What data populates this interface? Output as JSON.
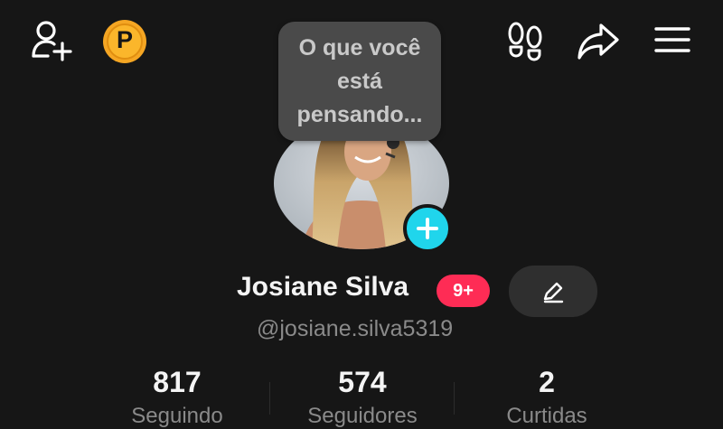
{
  "header": {
    "icons": [
      "add-friend-icon",
      "points-coin-icon",
      "footprints-icon",
      "share-icon",
      "menu-icon"
    ],
    "coin_letter": "P"
  },
  "profile": {
    "note_bubble": "O que você está pensando...",
    "name": "Josiane Silva",
    "notification_badge": "9+",
    "handle": "@josiane.silva5319"
  },
  "stats": [
    {
      "value": "817",
      "label": "Seguindo"
    },
    {
      "value": "574",
      "label": "Seguidores"
    },
    {
      "value": "2",
      "label": "Curtidas"
    }
  ],
  "colors": {
    "background": "#161616",
    "accent_cyan": "#20d5ec",
    "badge_red": "#fe2c55",
    "coin_gold": "#f5a623"
  }
}
